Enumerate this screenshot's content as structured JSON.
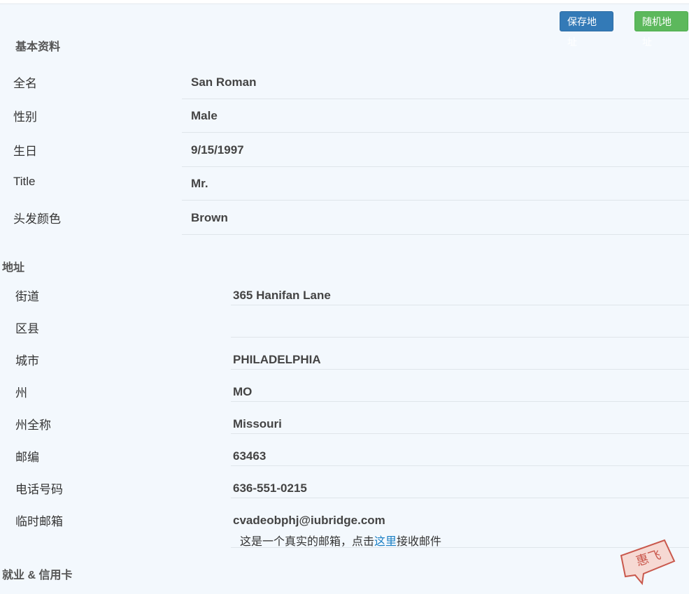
{
  "toolbar": {
    "save_label": "保存地址",
    "random_label": "随机地址"
  },
  "basic": {
    "title": "基本资料",
    "rows": [
      {
        "label": "全名",
        "value": "San Roman"
      },
      {
        "label": "性别",
        "value": "Male"
      },
      {
        "label": "生日",
        "value": "9/15/1997"
      },
      {
        "label": "Title",
        "value": "Mr."
      },
      {
        "label": "头发颜色",
        "value": "Brown"
      }
    ]
  },
  "address": {
    "title": "地址",
    "rows": [
      {
        "label": "街道",
        "value": "365  Hanifan Lane"
      },
      {
        "label": "区县",
        "value": ""
      },
      {
        "label": "城市",
        "value": "PHILADELPHIA"
      },
      {
        "label": "州",
        "value": "MO"
      },
      {
        "label": "州全称",
        "value": "Missouri"
      },
      {
        "label": "邮编",
        "value": "63463"
      },
      {
        "label": "电话号码",
        "value": "636-551-0215"
      },
      {
        "label": "临时邮箱",
        "value": "cvadeobphj@iubridge.com"
      }
    ],
    "email_note_prefix": "这是一个真实的邮箱，点击",
    "email_note_link": "这里",
    "email_note_suffix": "接收邮件"
  },
  "employment": {
    "title": "就业 & 信用卡"
  },
  "watermark": {
    "text": "惠飞"
  },
  "colors": {
    "save_button": "#337ab7",
    "random_button": "#5cb85c",
    "link": "#1a7fc4",
    "background": "#f3f8fd"
  }
}
